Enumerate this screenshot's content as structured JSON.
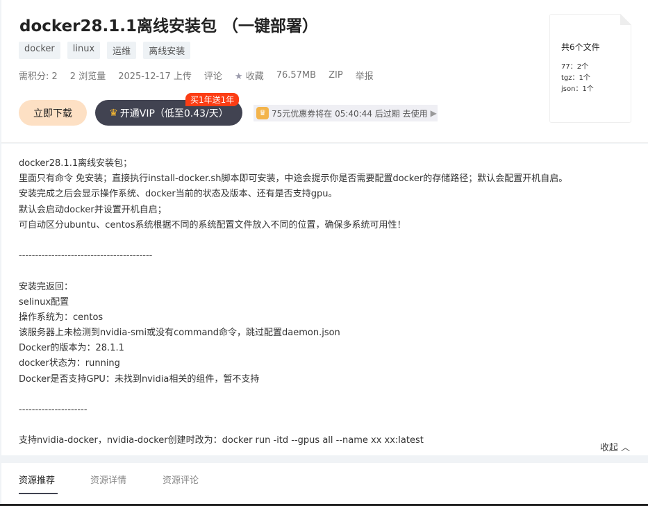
{
  "title": "docker28.1.1离线安装包 （一键部署）",
  "tags": [
    "docker",
    "linux",
    "运维",
    "离线安装"
  ],
  "meta": {
    "points": "需积分: 2",
    "views": "2 浏览量",
    "uploaded": "2025-12-17 上传",
    "comment": "评论",
    "favorite": "收藏",
    "size": "76.57MB",
    "format": "ZIP",
    "report": "举报"
  },
  "actions": {
    "download": "立即下载",
    "vip": "开通VIP（低至0.43/天）",
    "vip_badge": "买1年送1年",
    "coupon": "75元优惠券将在 05:40:44 后过期 去使用"
  },
  "files": {
    "total": "共6个文件",
    "items": [
      "77：2个",
      "tgz：1个",
      "json：1个"
    ]
  },
  "description": [
    "docker28.1.1离线安装包；",
    "里面只有命令 免安装；直接执行install-docker.sh脚本即可安装，中途会提示你是否需要配置docker的存储路径；默认会配置开机自启。",
    "安装完成之后会显示操作系统、docker当前的状态及版本、还有是否支持gpu。",
    "默认会启动docker并设置开机自启；",
    "可自动区分ubuntu、centos系统根据不同的系统配置文件放入不同的位置，确保多系统可用性！",
    "",
    "-----------------------------------------",
    "",
    "安装完返回：",
    "selinux配置",
    "操作系统为：centos",
    "该服务器上未检测到nvidia-smi或没有command命令，跳过配置daemon.json",
    "Docker的版本为：28.1.1",
    "docker状态为：running",
    "Docker是否支持GPU：未找到nvidia相关的组件，暂不支持",
    "",
    "---------------------",
    "",
    "支持nvidia-docker，nvidia-docker创建时改为：docker run -itd --gpus all --name xx xx:latest"
  ],
  "collapse": "收起",
  "tabs": [
    "资源推荐",
    "资源详情",
    "资源评论"
  ]
}
